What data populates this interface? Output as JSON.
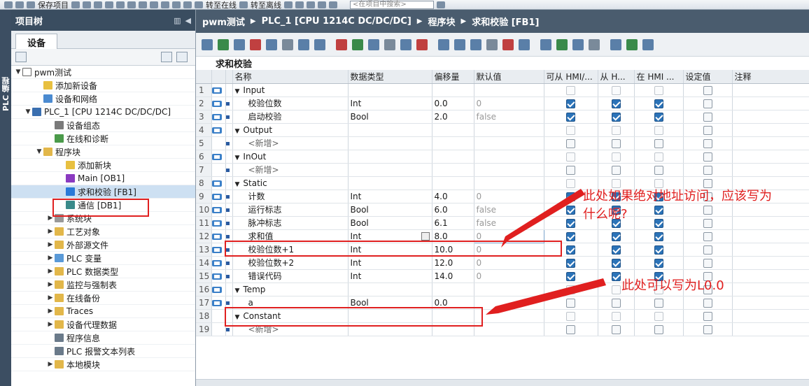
{
  "toolbar": {
    "save_label": "保存项目",
    "go_online": "转至在线",
    "go_offline": "转至离线",
    "search_placeholder": "<在项目中搜索>"
  },
  "side_strip_label": "PLC 编程",
  "tree_panel": {
    "title": "项目树",
    "tab": "设备",
    "items": [
      {
        "label": "pwm测试",
        "expander": "▼",
        "icon": "project-icon"
      },
      {
        "label": "添加新设备",
        "expander": "",
        "icon": "add-device-icon"
      },
      {
        "label": "设备和网络",
        "expander": "",
        "icon": "network-icon"
      },
      {
        "label": "PLC_1 [CPU 1214C DC/DC/DC]",
        "expander": "▼",
        "icon": "plc-icon"
      },
      {
        "label": "设备组态",
        "expander": "",
        "icon": "device-config-icon"
      },
      {
        "label": "在线和诊断",
        "expander": "",
        "icon": "diagnostics-icon"
      },
      {
        "label": "程序块",
        "expander": "▼",
        "icon": "folder-icon"
      },
      {
        "label": "添加新块",
        "expander": "",
        "icon": "add-block-icon"
      },
      {
        "label": "Main [OB1]",
        "expander": "",
        "icon": "ob-icon"
      },
      {
        "label": "求和校验 [FB1]",
        "expander": "",
        "icon": "fb-icon"
      },
      {
        "label": "通信 [DB1]",
        "expander": "",
        "icon": "db-icon"
      },
      {
        "label": "系统块",
        "expander": "▶",
        "icon": "system-blocks-icon"
      },
      {
        "label": "工艺对象",
        "expander": "▶",
        "icon": "folder-icon"
      },
      {
        "label": "外部源文件",
        "expander": "▶",
        "icon": "folder-icon"
      },
      {
        "label": "PLC 变量",
        "expander": "▶",
        "icon": "tag-icon"
      },
      {
        "label": "PLC 数据类型",
        "expander": "▶",
        "icon": "folder-icon"
      },
      {
        "label": "监控与强制表",
        "expander": "▶",
        "icon": "folder-icon"
      },
      {
        "label": "在线备份",
        "expander": "▶",
        "icon": "folder-icon"
      },
      {
        "label": "Traces",
        "expander": "▶",
        "icon": "folder-icon"
      },
      {
        "label": "设备代理数据",
        "expander": "▶",
        "icon": "folder-icon"
      },
      {
        "label": "程序信息",
        "expander": "",
        "icon": "program-info-icon"
      },
      {
        "label": "PLC 报警文本列表",
        "expander": "",
        "icon": "alarm-text-icon"
      },
      {
        "label": "本地模块",
        "expander": "▶",
        "icon": "folder-icon"
      }
    ]
  },
  "breadcrumb": [
    "pwm测试",
    "PLC_1 [CPU 1214C DC/DC/DC]",
    "程序块",
    "求和校验 [FB1]"
  ],
  "block_title": "求和校验",
  "table": {
    "headers": {
      "name": "名称",
      "type": "数据类型",
      "offset": "偏移量",
      "default": "默认值",
      "hmi_access": "可从 HMI/...",
      "hmi_visible": "从 H...",
      "hmi_settable": "在 HMI ...",
      "setpoint": "设定值",
      "comment": "注释"
    },
    "rows": [
      {
        "n": "1",
        "name": "Input",
        "section": true,
        "type": "",
        "offset": "",
        "default": "",
        "c1": false,
        "c2": false,
        "c3": false,
        "c4": false
      },
      {
        "n": "2",
        "name": "校验位数",
        "type": "Int",
        "offset": "0.0",
        "default": "0",
        "c1": true,
        "c2": true,
        "c3": true,
        "c4": false
      },
      {
        "n": "3",
        "name": "启动校验",
        "type": "Bool",
        "offset": "2.0",
        "default": "false",
        "c1": true,
        "c2": true,
        "c3": true,
        "c4": false
      },
      {
        "n": "4",
        "name": "Output",
        "section": true,
        "type": "",
        "offset": "",
        "default": "",
        "c1": false,
        "c2": false,
        "c3": false,
        "c4": false
      },
      {
        "n": "5",
        "name": "<新增>",
        "placeholder": true,
        "type": "",
        "offset": "",
        "default": "",
        "c1": false,
        "c2": false,
        "c3": false,
        "c4": false
      },
      {
        "n": "6",
        "name": "InOut",
        "section": true,
        "type": "",
        "offset": "",
        "default": "",
        "c1": false,
        "c2": false,
        "c3": false,
        "c4": false
      },
      {
        "n": "7",
        "name": "<新增>",
        "placeholder": true,
        "type": "",
        "offset": "",
        "default": "",
        "c1": false,
        "c2": false,
        "c3": false,
        "c4": false
      },
      {
        "n": "8",
        "name": "Static",
        "section": true,
        "type": "",
        "offset": "",
        "default": "",
        "c1": false,
        "c2": false,
        "c3": false,
        "c4": false
      },
      {
        "n": "9",
        "name": "计数",
        "type": "Int",
        "offset": "4.0",
        "default": "0",
        "c1": true,
        "c2": true,
        "c3": true,
        "c4": false
      },
      {
        "n": "10",
        "name": "运行标志",
        "type": "Bool",
        "offset": "6.0",
        "default": "false",
        "c1": true,
        "c2": true,
        "c3": true,
        "c4": false
      },
      {
        "n": "11",
        "name": "脉冲标志",
        "type": "Bool",
        "offset": "6.1",
        "default": "false",
        "c1": true,
        "c2": true,
        "c3": true,
        "c4": false
      },
      {
        "n": "12",
        "name": "求和值",
        "type": "Int",
        "offset": "8.0",
        "default": "0",
        "c1": true,
        "c2": true,
        "c3": true,
        "c4": false
      },
      {
        "n": "13",
        "name": "校验位数+1",
        "type": "Int",
        "offset": "10.0",
        "default": "0",
        "c1": true,
        "c2": true,
        "c3": true,
        "c4": false
      },
      {
        "n": "14",
        "name": "校验位数+2",
        "type": "Int",
        "offset": "12.0",
        "default": "0",
        "c1": true,
        "c2": true,
        "c3": true,
        "c4": false
      },
      {
        "n": "15",
        "name": "错误代码",
        "type": "Int",
        "offset": "14.0",
        "default": "0",
        "c1": true,
        "c2": true,
        "c3": true,
        "c4": false
      },
      {
        "n": "16",
        "name": "Temp",
        "section": true,
        "type": "",
        "offset": "",
        "default": "",
        "c1": false,
        "c2": false,
        "c3": false,
        "c4": false
      },
      {
        "n": "17",
        "name": "a",
        "type": "Bool",
        "offset": "0.0",
        "default": "",
        "c1": false,
        "c2": false,
        "c3": false,
        "c4": false
      },
      {
        "n": "18",
        "name": "Constant",
        "section": true,
        "type": "",
        "offset": "",
        "default": "",
        "c1": false,
        "c2": false,
        "c3": false,
        "c4": false
      },
      {
        "n": "19",
        "name": "<新增>",
        "placeholder": true,
        "type": "",
        "offset": "",
        "default": "",
        "c1": false,
        "c2": false,
        "c3": false,
        "c4": false
      }
    ]
  },
  "annotations": {
    "note1_line1": "此处如果绝对地址访问，应该写为",
    "note1_line2": "什么呢?",
    "note2": "此处可以写为L0.0"
  },
  "colors": {
    "annotation": "#e01f1f",
    "header_dark": "#3a4d60",
    "checkbox_on": "#2b73b8"
  }
}
